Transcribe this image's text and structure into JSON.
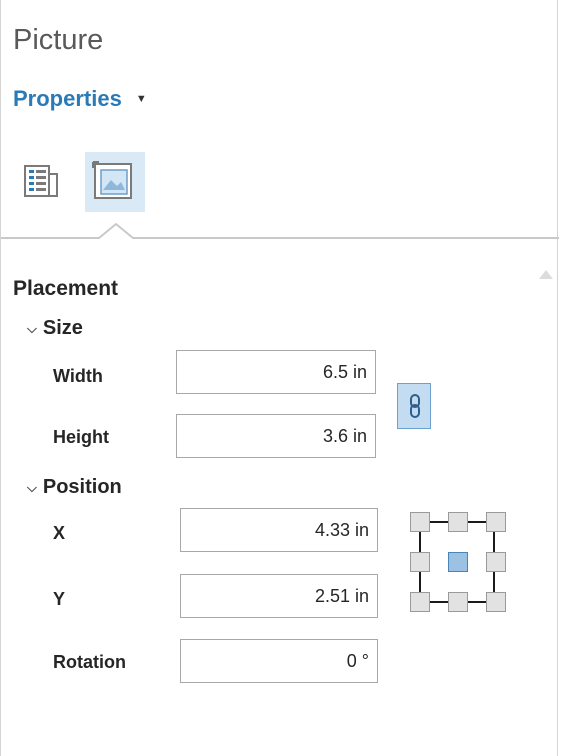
{
  "panel": {
    "title": "Picture",
    "menu_label": "Properties",
    "menu_caret": "▼"
  },
  "tabs": [
    {
      "icon": "list-properties-icon",
      "selected": false
    },
    {
      "icon": "picture-frame-icon",
      "selected": true
    }
  ],
  "section": {
    "title": "Placement",
    "size_group": {
      "label": "Size",
      "width_label": "Width",
      "width_value": "6.5 in",
      "height_label": "Height",
      "height_value": "3.6 in",
      "lock_icon": "chain-link-icon"
    },
    "position_group": {
      "label": "Position",
      "x_label": "X",
      "x_value": "4.33 in",
      "y_label": "Y",
      "y_value": "2.51 in",
      "rotation_label": "Rotation",
      "rotation_value": "0 °",
      "anchor_selected": "center"
    }
  },
  "colors": {
    "accent": "#2a7ab8",
    "tab_selected_bg": "#d9e9f6",
    "anchor_selected": "#9cc2e3"
  }
}
